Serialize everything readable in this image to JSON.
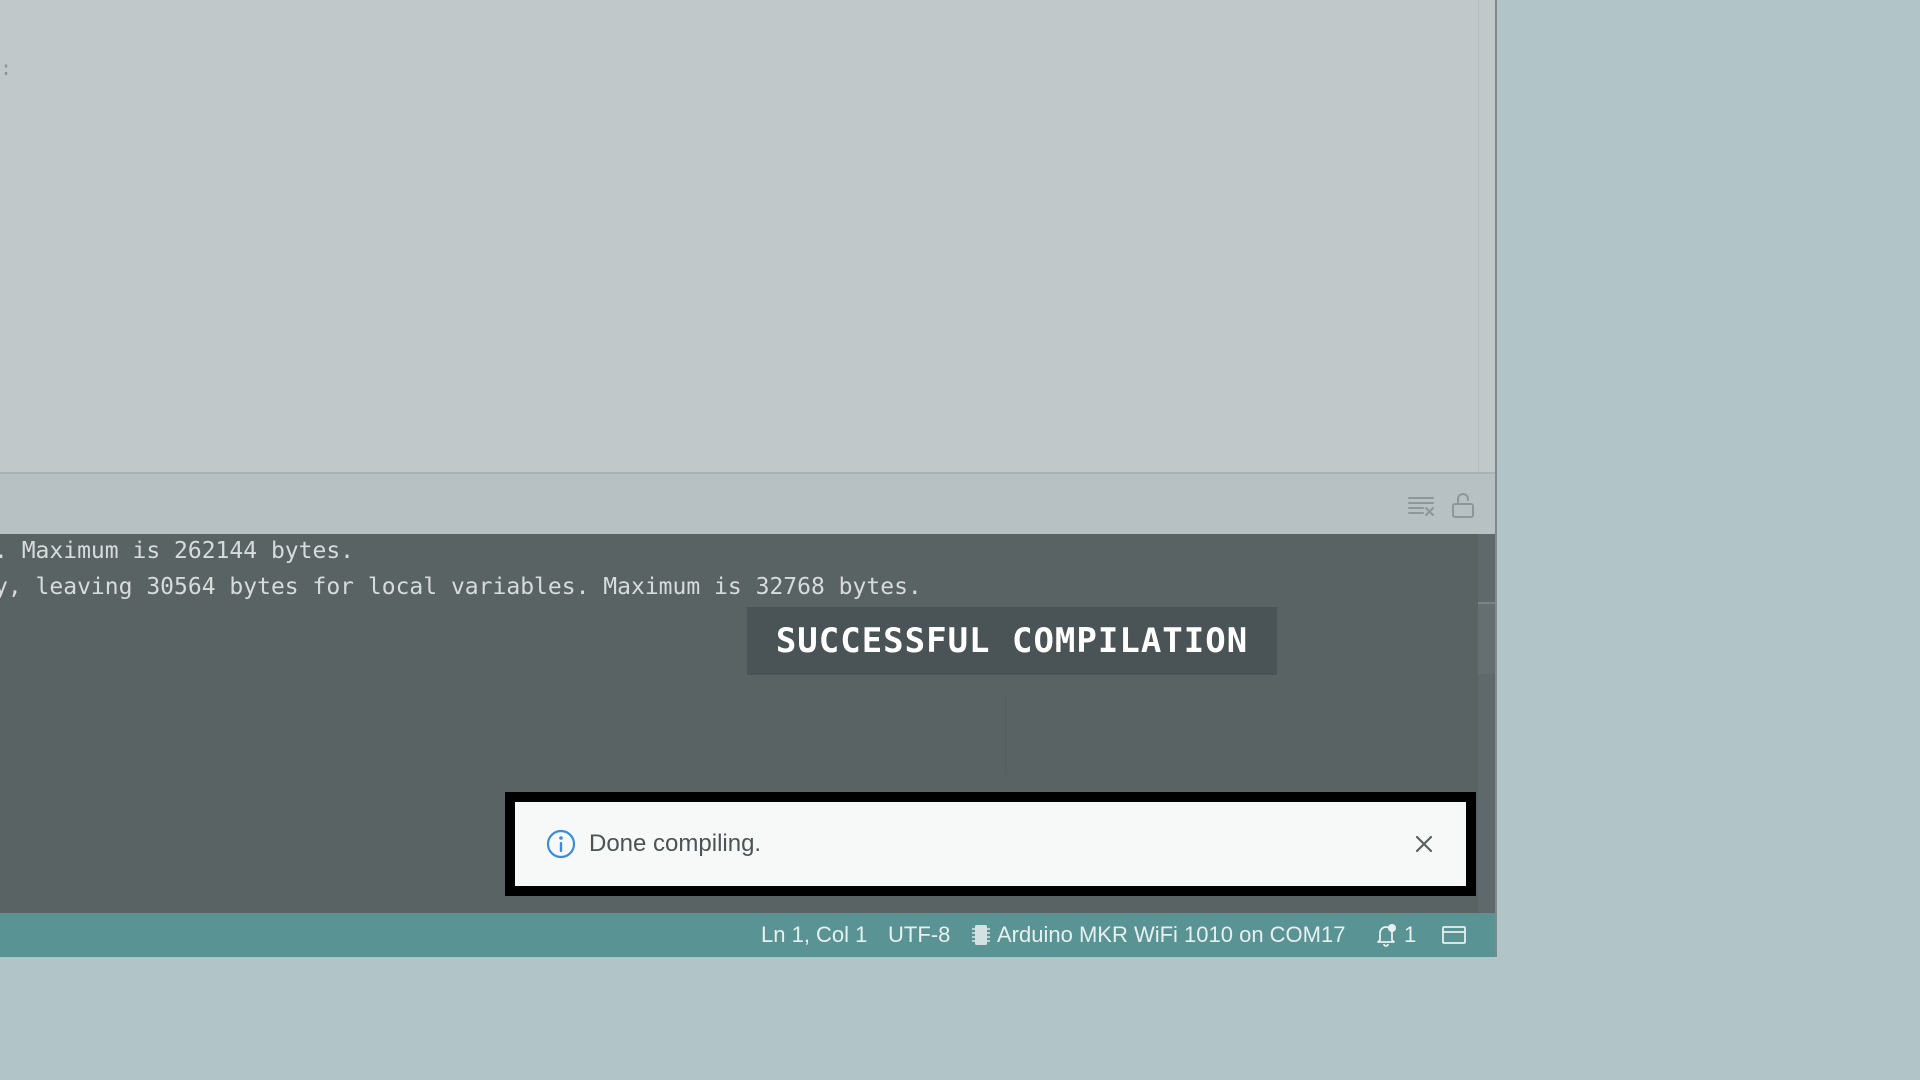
{
  "editor": {
    "fragment": ":"
  },
  "output": {
    "lines": [
      ". Maximum is 262144 bytes.",
      "y, leaving 30564 bytes for local variables. Maximum is 32768 bytes."
    ],
    "toolbar": {
      "clear_icon": "clear-output-icon",
      "lock_icon": "scroll-lock-icon"
    }
  },
  "caption": {
    "text": "SUCCESSFUL COMPILATION"
  },
  "notification": {
    "icon": "info-icon",
    "message": "Done compiling.",
    "close_icon": "close-icon"
  },
  "status_bar": {
    "cursor_position": "Ln 1, Col 1",
    "encoding": "UTF-8",
    "board_icon": "board-chip-icon",
    "board": "Arduino MKR WiFi 1010 on COM17",
    "notification_icon": "bell-icon",
    "notification_count": "1",
    "panel_icon": "toggle-panel-icon"
  },
  "colors": {
    "background": "#b1c4c8",
    "status_bar": "#5a9394",
    "console": "#5a6364",
    "info_icon": "#3b8dd9"
  }
}
